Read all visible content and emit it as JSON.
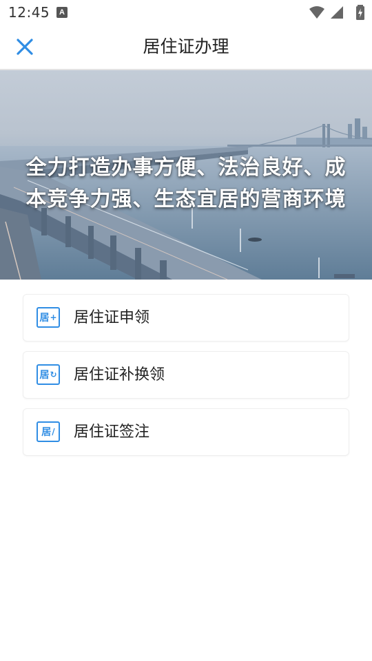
{
  "status_bar": {
    "time": "12:45",
    "notification_badge": "A",
    "icons": [
      "wifi-icon",
      "signal-icon",
      "battery-charging-icon"
    ]
  },
  "header": {
    "title": "居住证办理",
    "close_icon": "close-icon",
    "accent_color": "#2f8de4"
  },
  "banner": {
    "line1": "全力打造办事方便、法治良好、成",
    "line2": "本竞争力强、生态宜居的营商环境"
  },
  "menu": {
    "items": [
      {
        "label": "居住证申领",
        "icon_text": "居",
        "icon_mark": "+",
        "icon": "residence-apply-icon"
      },
      {
        "label": "居住证补换领",
        "icon_text": "居",
        "icon_mark": "↻",
        "icon": "residence-replace-icon"
      },
      {
        "label": "居住证签注",
        "icon_text": "居",
        "icon_mark": "/",
        "icon": "residence-endorse-icon"
      }
    ]
  }
}
